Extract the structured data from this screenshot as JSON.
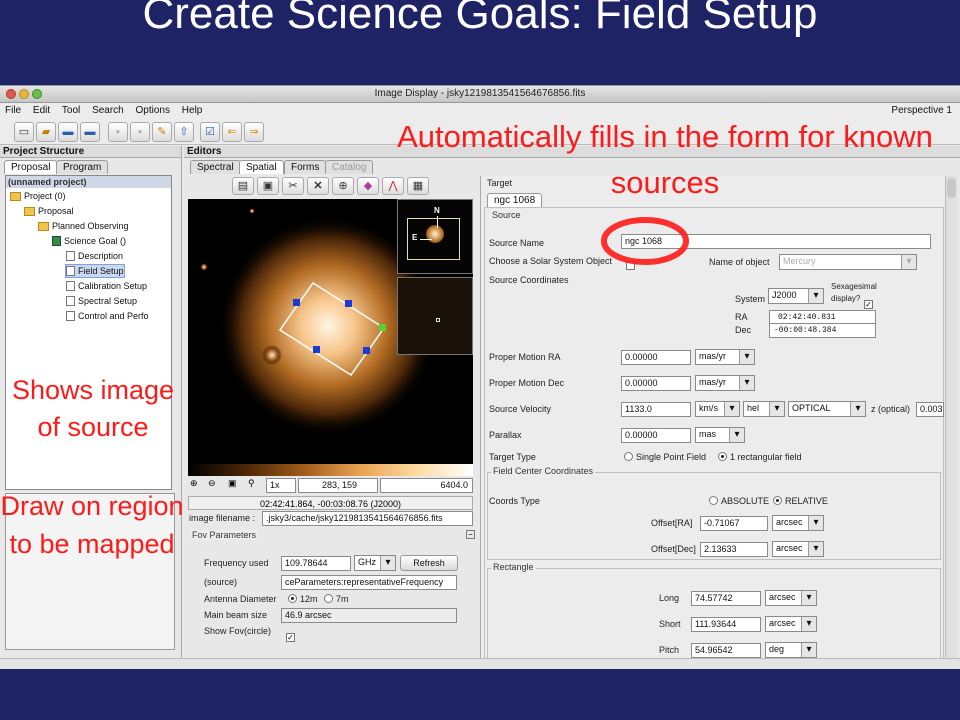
{
  "slide": {
    "title": "Create Science Goals: Field Setup"
  },
  "window": {
    "title": "Image Display - jsky1219813541564676856.fits",
    "menu": [
      "File",
      "Edit",
      "Tool",
      "Search",
      "Options",
      "Help"
    ],
    "perspective": "Perspective 1"
  },
  "left_panel": {
    "header": "Project Structure",
    "tabs": [
      "Proposal",
      "Program"
    ],
    "root_label": "(unnamed project)",
    "tree": [
      {
        "label": "Project (0)",
        "indent": 0,
        "icon": "folder"
      },
      {
        "label": "Proposal",
        "indent": 1,
        "icon": "folder"
      },
      {
        "label": "Planned Observing",
        "indent": 2,
        "icon": "folder"
      },
      {
        "label": "Science Goal ()",
        "indent": 3,
        "icon": "goal"
      },
      {
        "label": "Description",
        "indent": 4,
        "icon": "doc"
      },
      {
        "label": "Field Setup",
        "indent": 4,
        "icon": "doc",
        "selected": true
      },
      {
        "label": "Calibration Setup",
        "indent": 4,
        "icon": "doc"
      },
      {
        "label": "Spectral Setup",
        "indent": 4,
        "icon": "doc"
      },
      {
        "label": "Control and Perfo",
        "indent": 4,
        "icon": "doc"
      }
    ]
  },
  "editors": {
    "header": "Editors",
    "tabs": [
      "Spectral",
      "Spatial",
      "Forms",
      "Catalog"
    ],
    "active_tab": "Spatial"
  },
  "image_view": {
    "status_zoom": "1x",
    "status_pixel": "283, 159",
    "status_value": "6404.0",
    "coords": "02:42:41.864, -00:03:08.76 (J2000)",
    "filename_label": "image filename :",
    "filename_value": ".jsky3/cache/jsky1219813541564676856.fits",
    "compass_n": "N",
    "compass_e": "E"
  },
  "fov": {
    "title": "Fov Parameters",
    "frequency_label": "Frequency used",
    "frequency_value": "109.78644",
    "frequency_unit": "GHz",
    "refresh_label": "Refresh",
    "source_label": "(source)",
    "source_value": "ceParameters:representativeFrequency",
    "antenna_label": "Antenna Diameter",
    "antenna_opt1": "12m",
    "antenna_opt2": "7m",
    "beam_label": "Main beam size",
    "beam_value": "46.9 arcsec",
    "show_fov_label": "Show Fov(circle)"
  },
  "target": {
    "title": "Target",
    "tab": "ngc 1068",
    "source_section": "Source",
    "source_name_label": "Source Name",
    "source_name_value": "ngc 1068",
    "solar_label": "Choose a Solar System Object",
    "name_of_object_label": "Name of object",
    "name_of_object_value": "Mercury",
    "coords_label": "Source Coordinates",
    "system_label": "System",
    "system_value": "J2000",
    "sexagesimal_label": "Sexagesimal",
    "display_label": "display?",
    "ra_label": "RA",
    "ra_value": "02:42:40.831",
    "dec_label": "Dec",
    "dec_value": "-00:00:48.384",
    "pm_ra_label": "Proper Motion RA",
    "pm_ra_value": "0.00000",
    "pm_ra_unit": "mas/yr",
    "pm_dec_label": "Proper Motion Dec",
    "pm_dec_value": "0.00000",
    "pm_dec_unit": "mas/yr",
    "velocity_label": "Source Velocity",
    "velocity_value": "1133.0",
    "velocity_unit": "km/s",
    "velocity_frame": "hel",
    "velocity_def": "OPTICAL",
    "z_label": "z (optical)",
    "z_value": "0.003",
    "parallax_label": "Parallax",
    "parallax_value": "0.00000",
    "parallax_unit": "mas",
    "target_type_label": "Target Type",
    "tt_opt1": "Single Point Field",
    "tt_opt2": "1 rectangular field"
  },
  "field_center": {
    "title": "Field Center Coordinates",
    "coords_type_label": "Coords Type",
    "opt_absolute": "ABSOLUTE",
    "opt_relative": "RELATIVE",
    "offset_ra_label": "Offset[RA]",
    "offset_ra_value": "-0.71067",
    "offset_ra_unit": "arcsec",
    "offset_dec_label": "Offset[Dec]",
    "offset_dec_value": "2.13633",
    "offset_dec_unit": "arcsec"
  },
  "rectangle": {
    "title": "Rectangle",
    "long_label": "Long",
    "long_value": "74.57742",
    "long_unit": "arcsec",
    "short_label": "Short",
    "short_value": "111.93644",
    "short_unit": "arcsec",
    "pitch_label": "Pitch",
    "pitch_value": "54.96542",
    "pitch_unit": "deg"
  },
  "annotations": {
    "top_right": "Automatically fills in the form for known sources",
    "left_middle": "Shows image of source",
    "left_bottom": "Draw on region to be mapped"
  },
  "colors": {
    "slide_background": "#1e2366",
    "annotation_red": "#ff1a1a"
  }
}
